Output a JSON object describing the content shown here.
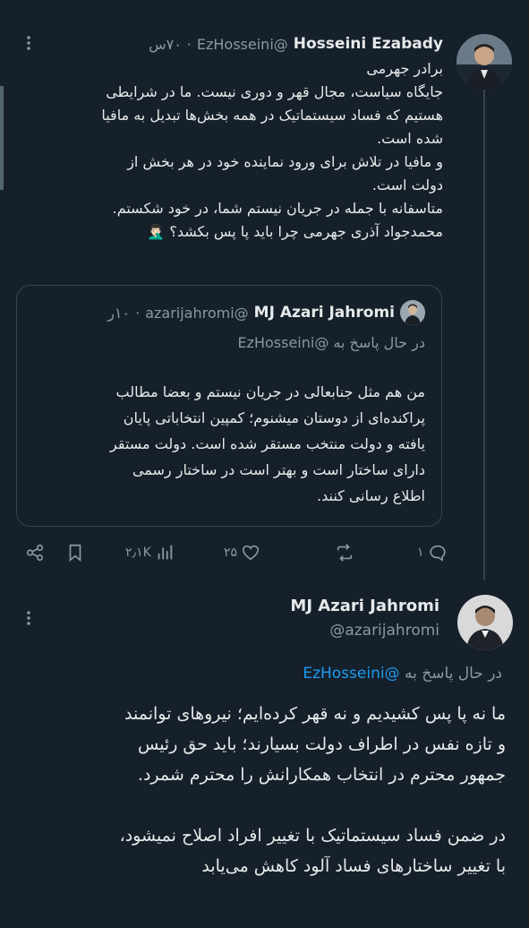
{
  "tweet1": {
    "author_name": "Hosseini Ezabady",
    "author_handle": "@EzHosseini",
    "time": "۷۰س",
    "body_lines": [
      "برادر جهرمی",
      "جایگاه سیاست، مجال قهر و دوری نیست. ما در شرایطی",
      "هستیم که فساد سیستماتیک در همه بخش‌ها تبدیل به مافیا",
      "شده است.",
      "و مافیا در تلاش برای ورود نماینده خود در هر بخش از",
      "دولت است.",
      "متاسفانه با جمله در جریان نیستم شما، در خود شکستم.",
      "محمدجواد آذری جهرمی چرا باید پا پس بکشد؟ 🤦🏻‍♂️"
    ],
    "quote": {
      "author_name": "MJ Azari Jahromi",
      "author_handle": "@azarijahromi",
      "time": "۱۰ر",
      "reply_to": "در حال پاسخ به @EzHosseini",
      "body_lines": [
        "من هم مثل جنابعالی در جریان نیستم و بعضا مطالب",
        "پراکنده‌ای از دوستان میشنوم؛ کمپین انتخاباتی پایان",
        "یافته و دولت منتخب مستقر شده است. دولت مستقر",
        "دارای ساختار است و بهتر است در ساختار رسمی",
        "اطلاع رسانی کنند."
      ]
    },
    "actions": {
      "reply_count": "۱",
      "retweet_count": "",
      "like_count": "۲۵",
      "views_count": "۲٫۱K"
    }
  },
  "tweet2": {
    "author_name": "MJ Azari Jahromi",
    "author_handle": "@azarijahromi",
    "reply_prefix": "در حال پاسخ به",
    "reply_mention": "@EzHosseini",
    "body_lines": [
      "ما نه پا پس کشیدیم و نه قهر کرده‌ایم؛ نیروهای توانمند",
      "و تازه نفس در اطراف دولت بسیارند؛ باید حق رئیس",
      "جمهور محترم در انتخاب همکارانش را محترم شمرد."
    ],
    "body_lines_2": [
      "در ضمن فساد سیستماتیک با تغییر افراد اصلاح نمیشود،",
      "با تغییر ساختارهای فساد آلود کاهش می‌یابد"
    ]
  },
  "colors": {
    "background": "#15202b",
    "text": "#e7e9ea",
    "muted": "#8b98a5",
    "accent": "#1d9bf0",
    "border": "#38444d"
  }
}
